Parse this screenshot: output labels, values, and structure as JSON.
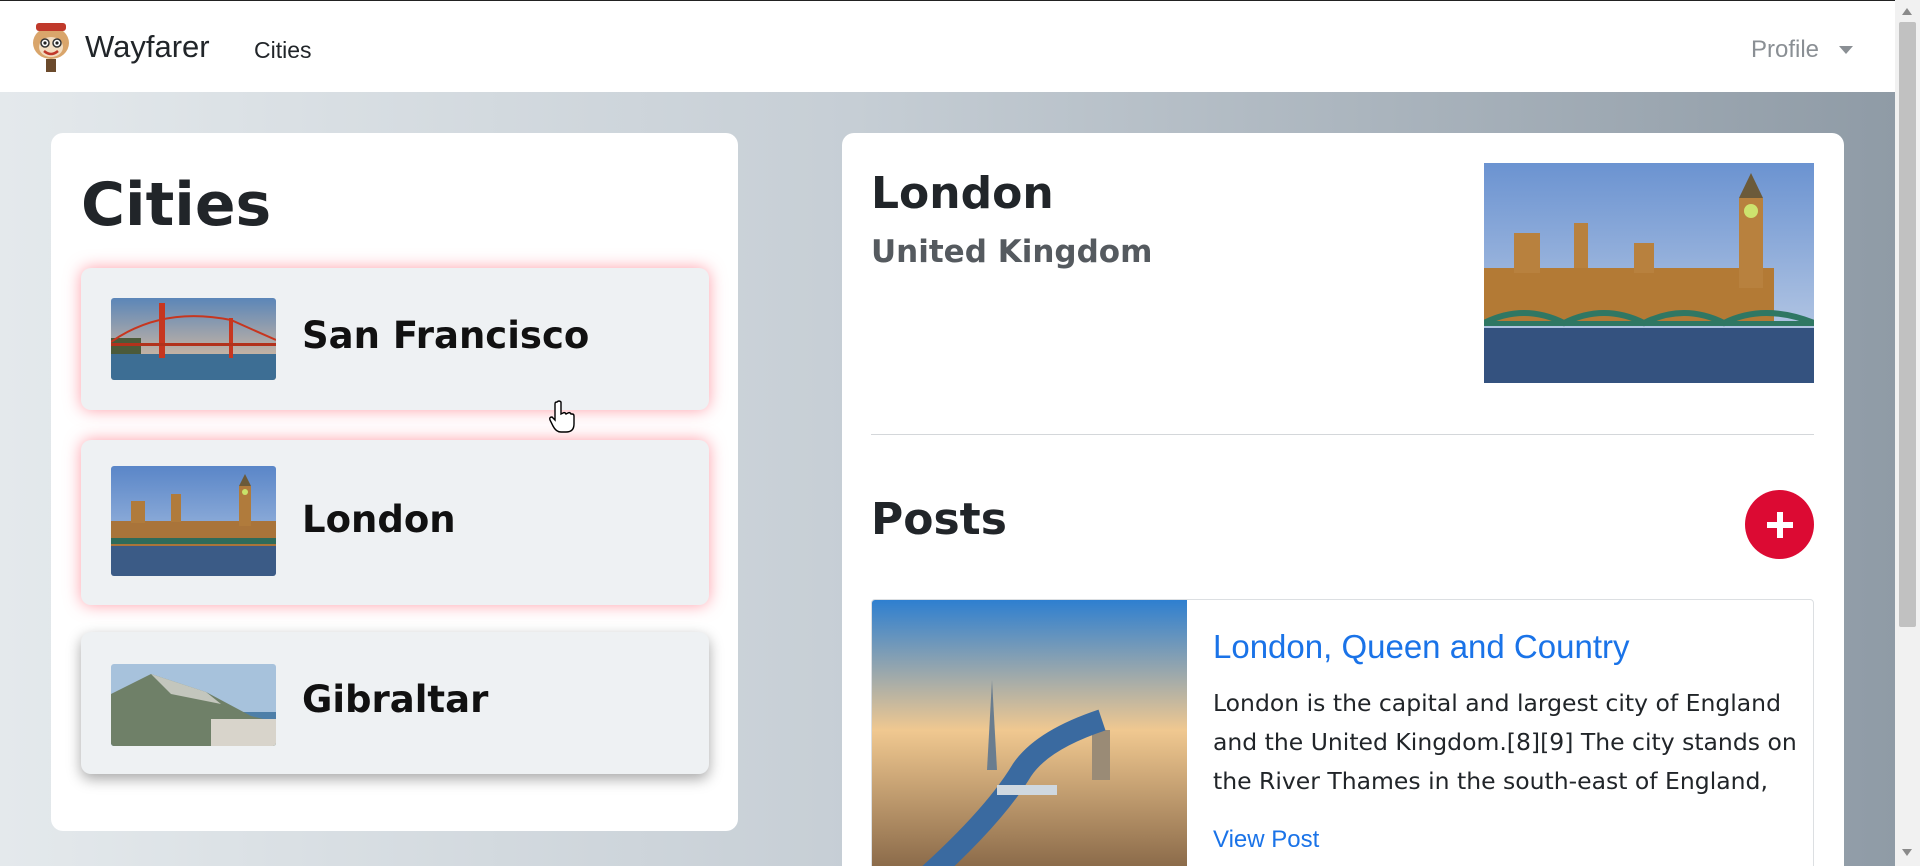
{
  "navbar": {
    "brand": "Wayfarer",
    "cities_link": "Cities",
    "profile_label": "Profile"
  },
  "cities_panel": {
    "title": "Cities",
    "items": [
      {
        "name": "San Francisco",
        "image": "golden-gate-bridge"
      },
      {
        "name": "London",
        "image": "westminster"
      },
      {
        "name": "Gibraltar",
        "image": "rock-of-gibraltar"
      }
    ]
  },
  "detail": {
    "city": "London",
    "country": "United Kingdom",
    "image": "westminster-palace",
    "posts_title": "Posts",
    "add_icon": "plus-icon",
    "post": {
      "title": "London, Queen and Country",
      "body": "London is the capital and largest city of England and the United Kingdom.[8][9] The city stands on the River Thames in the south-east of England, at",
      "link": "View Post",
      "image": "london-aerial"
    }
  },
  "colors": {
    "accent_red": "#dc0a33",
    "link_blue": "#1a73e8"
  }
}
